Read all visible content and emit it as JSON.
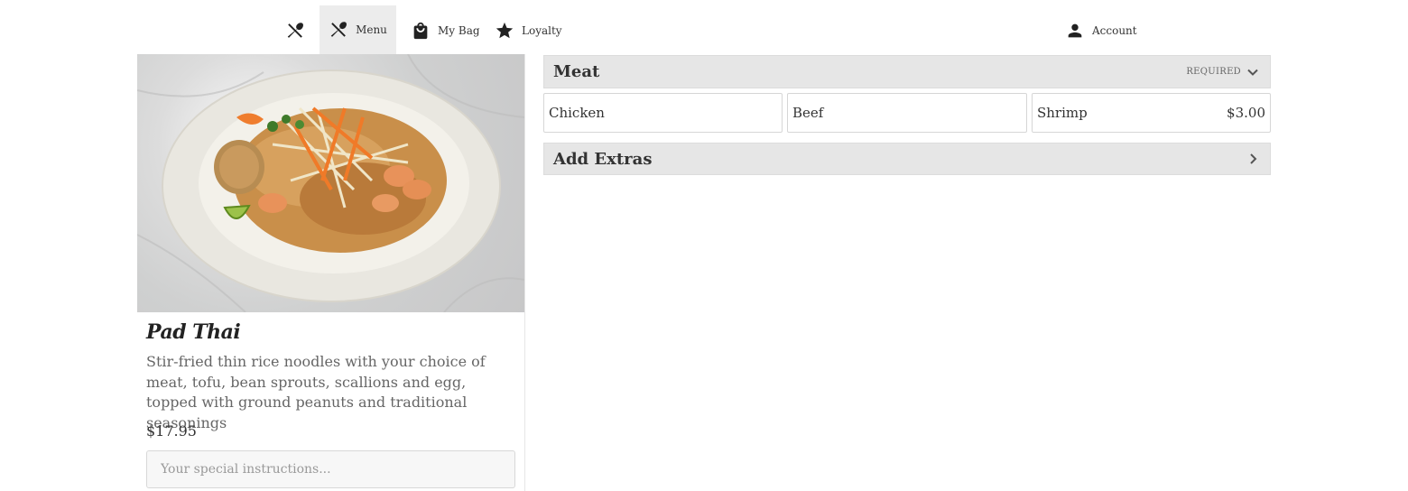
{
  "nav": {
    "logo_icon": "utensils-icon",
    "items": [
      {
        "label": "Menu",
        "icon": "utensils-icon"
      },
      {
        "label": "My Bag",
        "icon": "bag-icon"
      },
      {
        "label": "Loyalty",
        "icon": "star-icon"
      }
    ],
    "account": {
      "label": "Account",
      "icon": "person-icon"
    }
  },
  "item": {
    "name": "Pad Thai",
    "description": "Stir-fried thin rice noodles with your choice of meat, tofu, bean sprouts, scallions and egg, topped with ground peanuts and traditional seasonings",
    "price": "$17.95",
    "instructions_placeholder": "Your special instructions..."
  },
  "groups": {
    "meat": {
      "title": "Meat",
      "badge": "REQUIRED",
      "options": [
        {
          "label": "Chicken",
          "price": ""
        },
        {
          "label": "Beef",
          "price": ""
        },
        {
          "label": "Shrimp",
          "price": "$3.00"
        }
      ]
    },
    "extras": {
      "title": "Add Extras"
    }
  },
  "colors": {
    "header_bg": "#e6e6e6",
    "active_tab_bg": "#ececec",
    "text": "#333333"
  }
}
